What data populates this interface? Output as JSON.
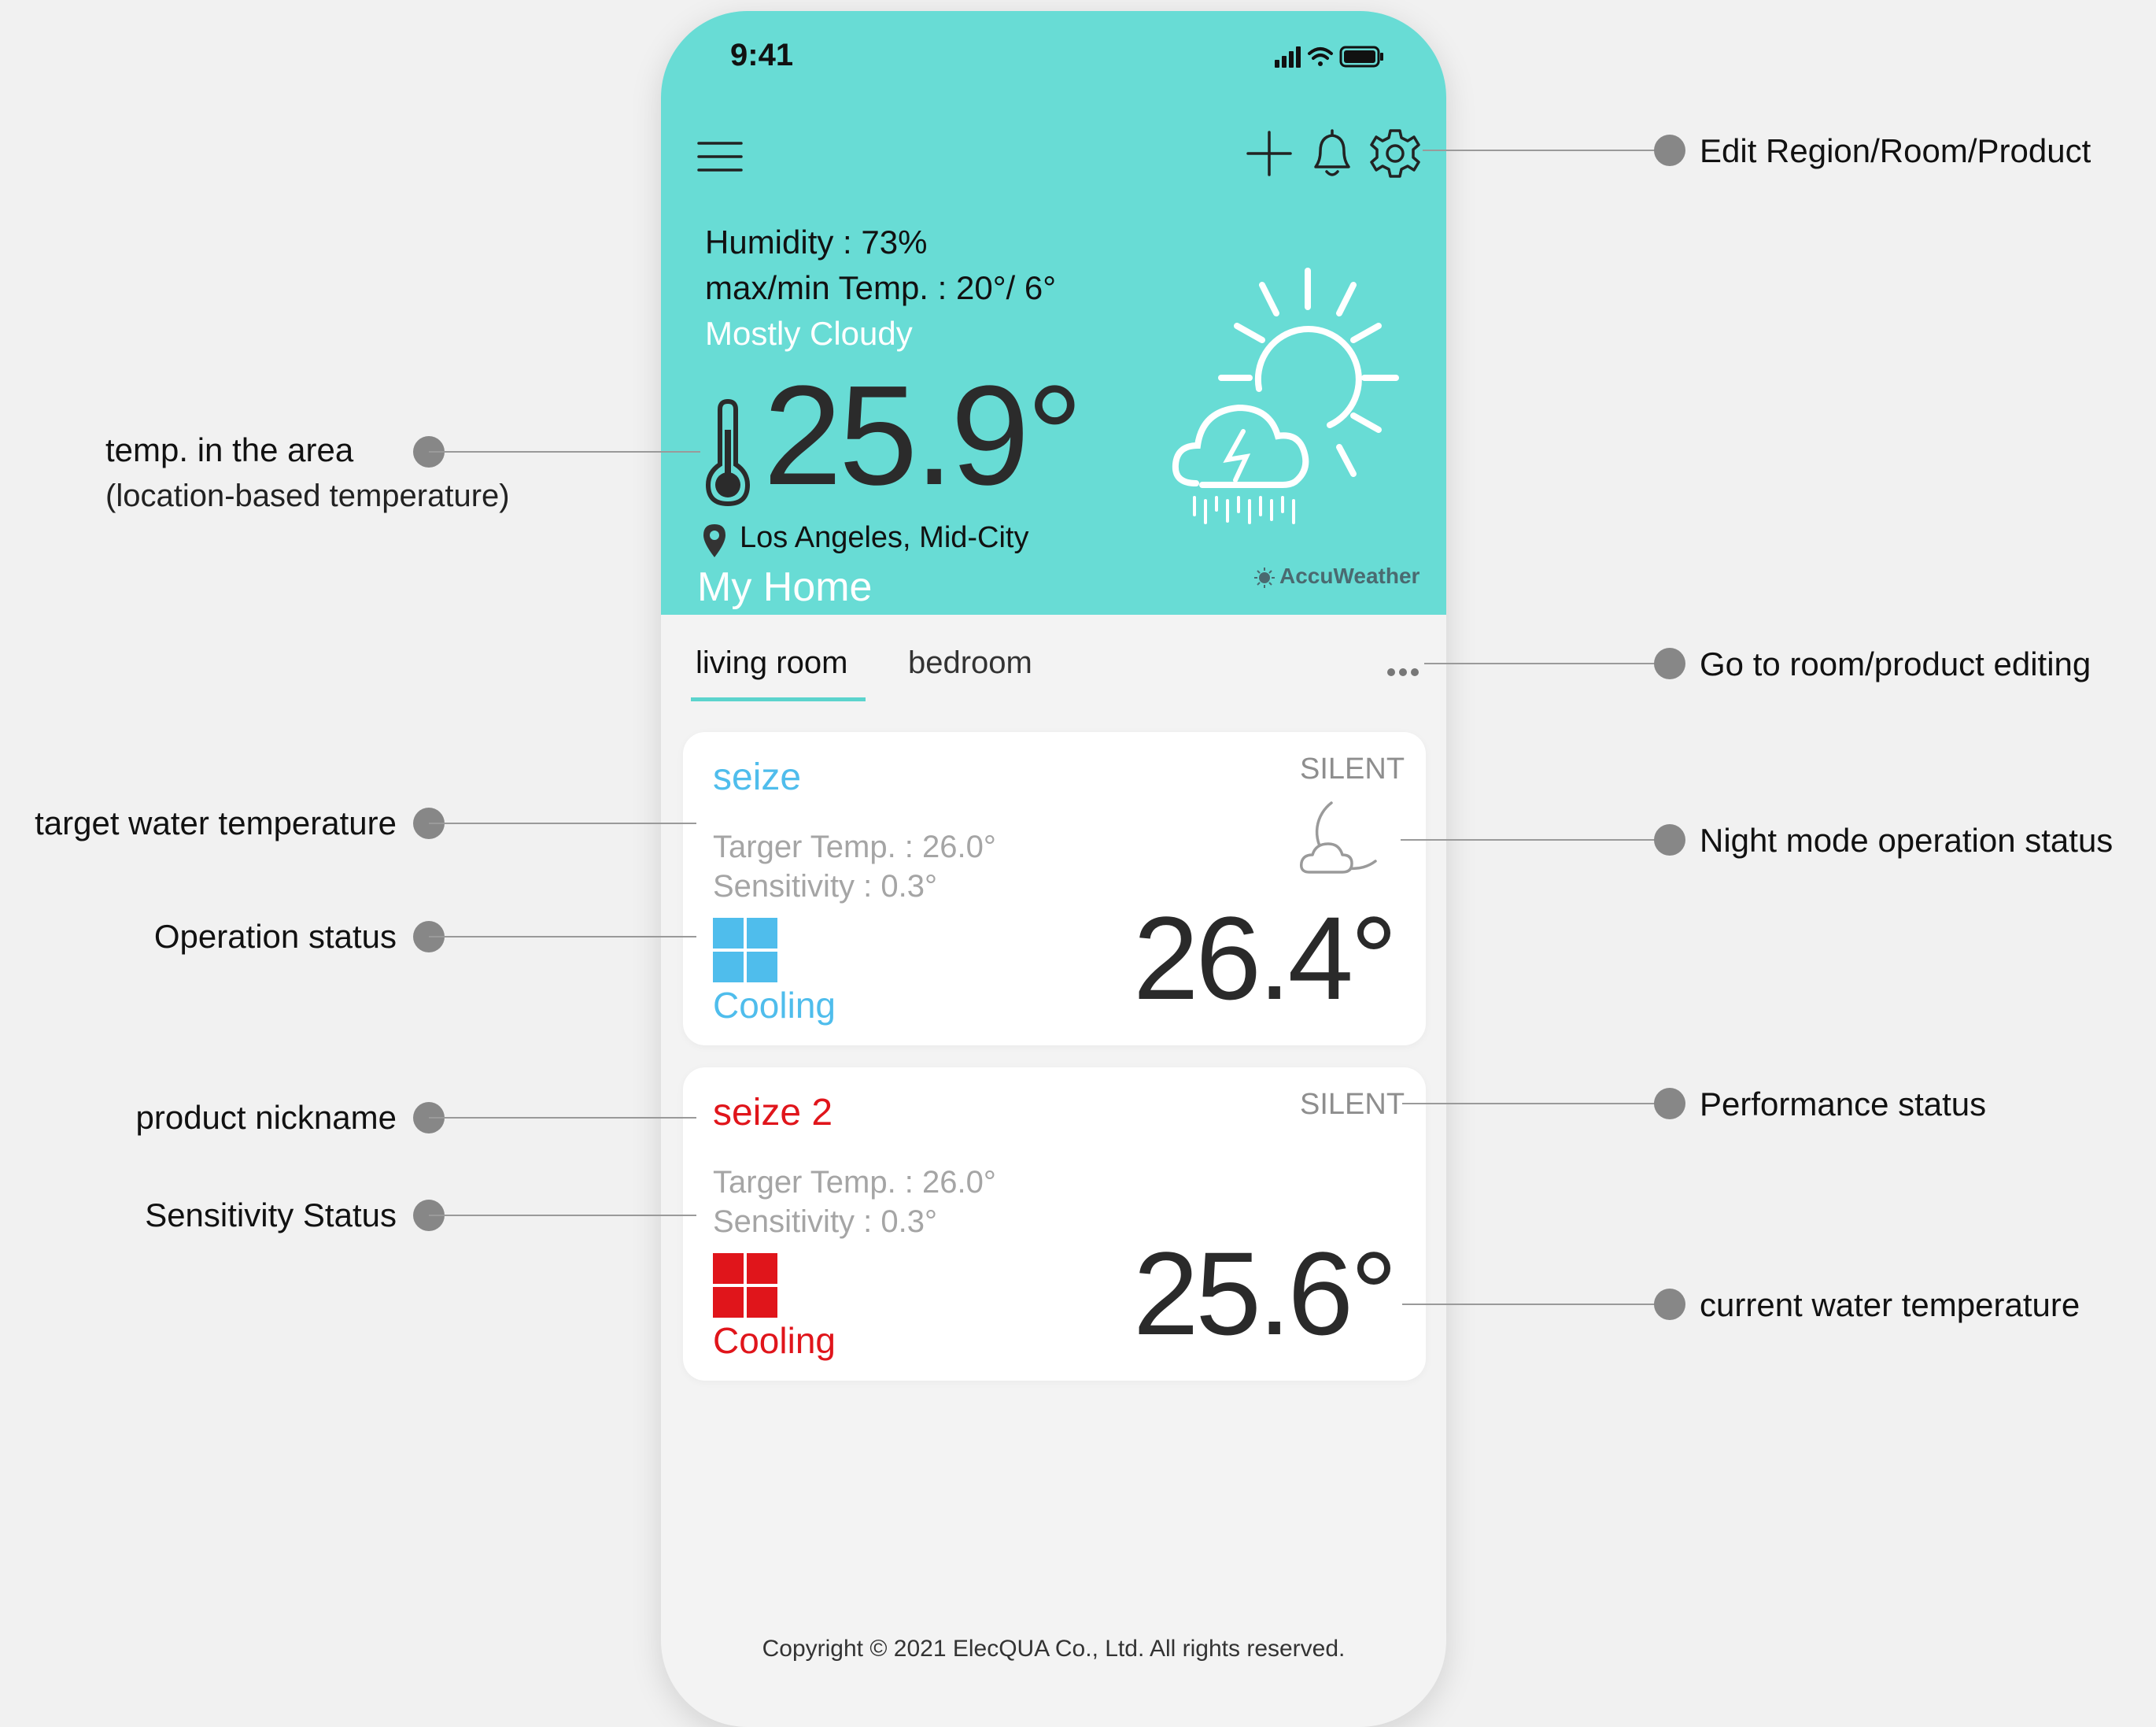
{
  "status_bar": {
    "time": "9:41"
  },
  "weather": {
    "humidity": "Humidity : 73%",
    "maxmin": "max/min Temp. : 20°/ 6°",
    "condition": "Mostly Cloudy",
    "current_temp": "25.9°",
    "location": "Los Angeles, Mid-City",
    "home": "My Home",
    "provider": "AccuWeather"
  },
  "tabs": [
    {
      "label": "living room",
      "active": true
    },
    {
      "label": "bedroom",
      "active": false
    }
  ],
  "products": [
    {
      "nickname": "seize",
      "mode": "SILENT",
      "target": "Targer Temp. : 26.0°",
      "sensitivity": "Sensitivity : 0.3°",
      "operation": "Cooling",
      "current_temp": "26.4°",
      "color": "#4fbdec",
      "night_mode": true
    },
    {
      "nickname": "seize 2",
      "mode": "SILENT",
      "target": "Targer Temp. : 26.0°",
      "sensitivity": "Sensitivity : 0.3°",
      "operation": "Cooling",
      "current_temp": "25.6°",
      "color": "#e0151b",
      "night_mode": false
    }
  ],
  "footer": {
    "copyright": "Copyright © 2021 ElecQUA Co., Ltd. All rights reserved."
  },
  "annotations": {
    "edit": "Edit Region/Room/Product",
    "area_temp": "temp. in the area",
    "area_temp_sub": "(location-based temperature)",
    "room_edit": "Go to room/product editing",
    "target_temp": "target water temperature",
    "night_mode": "Night mode operation status",
    "operation": "Operation status",
    "nickname": "product nickname",
    "performance": "Performance status",
    "sensitivity": "Sensitivity Status",
    "current_temp": "current water temperature"
  },
  "colors": {
    "header": "#68dcd5",
    "accent_tab": "#5bd4cd",
    "cooling_blue": "#4fbdec",
    "cooling_red": "#e0151b"
  },
  "icons": [
    "menu-icon",
    "plus-icon",
    "bell-icon",
    "gear-icon",
    "signal-icon",
    "wifi-icon",
    "battery-icon",
    "thermometer-icon",
    "location-pin-icon",
    "sun-storm-cloud-icon",
    "more-dots-icon",
    "moon-cloud-icon",
    "grid-mode-icon"
  ]
}
